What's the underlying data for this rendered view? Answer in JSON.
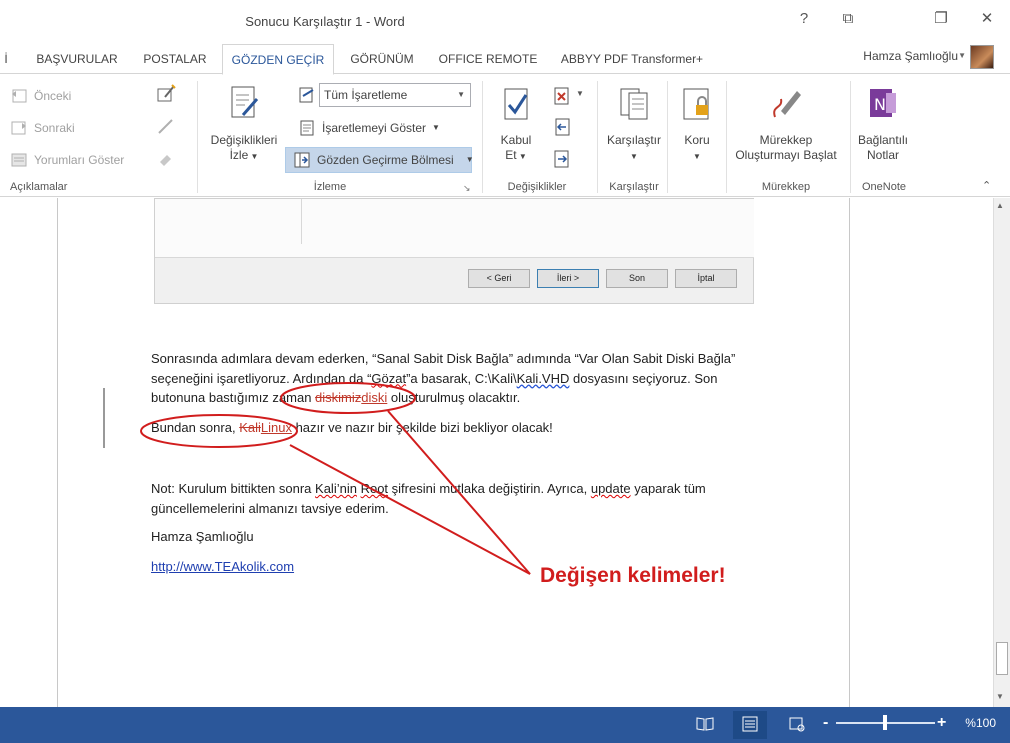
{
  "window": {
    "title": "Sonucu Karşılaştır 1 - Word",
    "help": "?",
    "ribbon_display": "⧉",
    "restore": "❐",
    "close": "✕"
  },
  "tabs": [
    {
      "label": "İ"
    },
    {
      "label": "BAŞVURULAR"
    },
    {
      "label": "POSTALAR"
    },
    {
      "label": "GÖZDEN GEÇİR"
    },
    {
      "label": "GÖRÜNÜM"
    },
    {
      "label": "OFFICE REMOTE"
    },
    {
      "label": "ABBYY PDF Transformer+"
    }
  ],
  "user": {
    "name": "Hamza Şamlıoğlu"
  },
  "ribbon": {
    "comments": {
      "previous": "Önceki",
      "next": "Sonraki",
      "show_comments": "Yorumları Göster",
      "group_label": "Açıklamalar"
    },
    "tracking": {
      "track_changes": "Değişiklikleri",
      "track_changes2": "İzle",
      "markup_select": "Tüm İşaretleme",
      "show_markup": "İşaretlemeyi Göster",
      "review_pane": "Gözden Geçirme Bölmesi",
      "group_label": "İzleme"
    },
    "changes": {
      "accept": "Kabul",
      "accept2": "Et",
      "group_label": "Değişiklikler"
    },
    "compare": {
      "label": "Karşılaştır",
      "group_label": "Karşılaştır"
    },
    "protect": {
      "label": "Koru"
    },
    "ink": {
      "label1": "Mürekkep",
      "label2": "Oluşturmayı Başlat",
      "group_label": "Mürekkep"
    },
    "onenote": {
      "label1": "Bağlantılı",
      "label2": "Notlar",
      "group_label": "OneNote"
    }
  },
  "dialog": {
    "back": "< Geri",
    "next": "İleri >",
    "finish": "Son",
    "cancel": "İptal"
  },
  "document": {
    "p1_line1": "Sonrasında adımlara devam ederken, “Sanal Sabit Disk Bağla” adımında “Var Olan Sabit Diski Bağla”",
    "p1_line2_a": "seçeneğini işaretliyoruz. Ardından da “",
    "p1_line2_gozat": "Gözat",
    "p1_line2_b": "”a basarak, C:\\Kali\\",
    "p1_line2_kali": "Kali.VHD",
    "p1_line2_c": " dosyasını seçiyoruz.  Son",
    "p1_line3_a": "butonuna bastığımız zaman ",
    "p1_line3_del": "diskimiz",
    "p1_line3_ins": "diski",
    "p1_line3_b": " oluşturulmuş olacaktır.",
    "p2_a": "Bundan sonra, ",
    "p2_del": "Kali",
    "p2_ins": "Linux",
    "p2_b": " hazır ve nazır bir şekilde bizi bekliyor olacak!",
    "p3_line1_a": "Not: Kurulum bittikten sonra ",
    "p3_kali": "Kali’nin",
    "p3_line1_b": " ",
    "p3_root": "Root",
    "p3_line1_c": " şifresini mutlaka değiştirin. Ayrıca, ",
    "p3_update": "update",
    "p3_line1_d": " yaparak tüm",
    "p3_line2": "güncellemelerini almanızı tavsiye ederim.",
    "signature": "Hamza Şamlıoğlu",
    "link": "http://www.TEAkolik.com"
  },
  "annotation": {
    "text": "Değişen kelimeler!",
    "color": "#d11d1d"
  },
  "status": {
    "zoom": "%100",
    "minus": "-",
    "plus": "+",
    "zoom_level_percent": 100
  },
  "colors": {
    "accent": "#2b579a",
    "revision": "#c0392b"
  }
}
